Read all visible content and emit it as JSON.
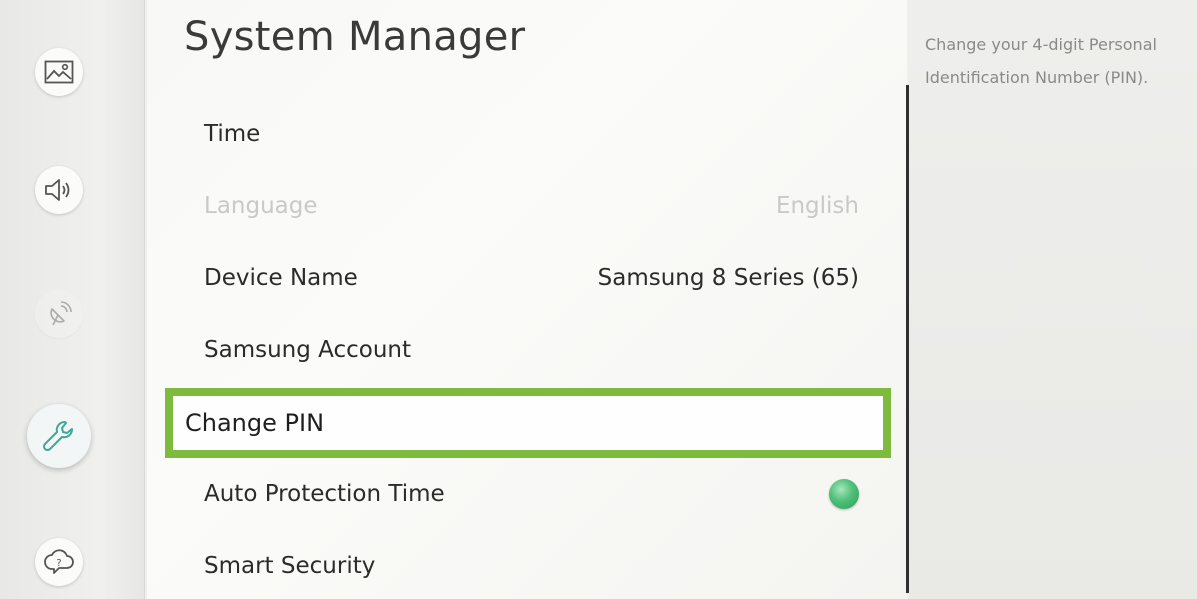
{
  "rail": {
    "icons": [
      {
        "name": "picture-icon",
        "state": "normal"
      },
      {
        "name": "sound-icon",
        "state": "normal"
      },
      {
        "name": "broadcast-icon",
        "state": "dim"
      },
      {
        "name": "wrench-icon",
        "state": "active"
      },
      {
        "name": "support-icon",
        "state": "normal"
      }
    ]
  },
  "main": {
    "title": "System Manager",
    "items": [
      {
        "label": "Time",
        "value": ""
      },
      {
        "label": "Language",
        "value": "English",
        "disabled": true
      },
      {
        "label": "Device Name",
        "value": "Samsung 8 Series (65)"
      },
      {
        "label": "Samsung Account",
        "value": ""
      },
      {
        "label": "Change PIN",
        "value": "",
        "selected": true
      },
      {
        "label": "Auto Protection Time",
        "value": "",
        "toggle": "on"
      },
      {
        "label": "Smart Security",
        "value": ""
      }
    ]
  },
  "help": {
    "text": "Change your 4-digit Personal Identification Number (PIN)."
  },
  "colors": {
    "focus_border": "#7dba3d",
    "toggle_on": "#4cbf78"
  }
}
